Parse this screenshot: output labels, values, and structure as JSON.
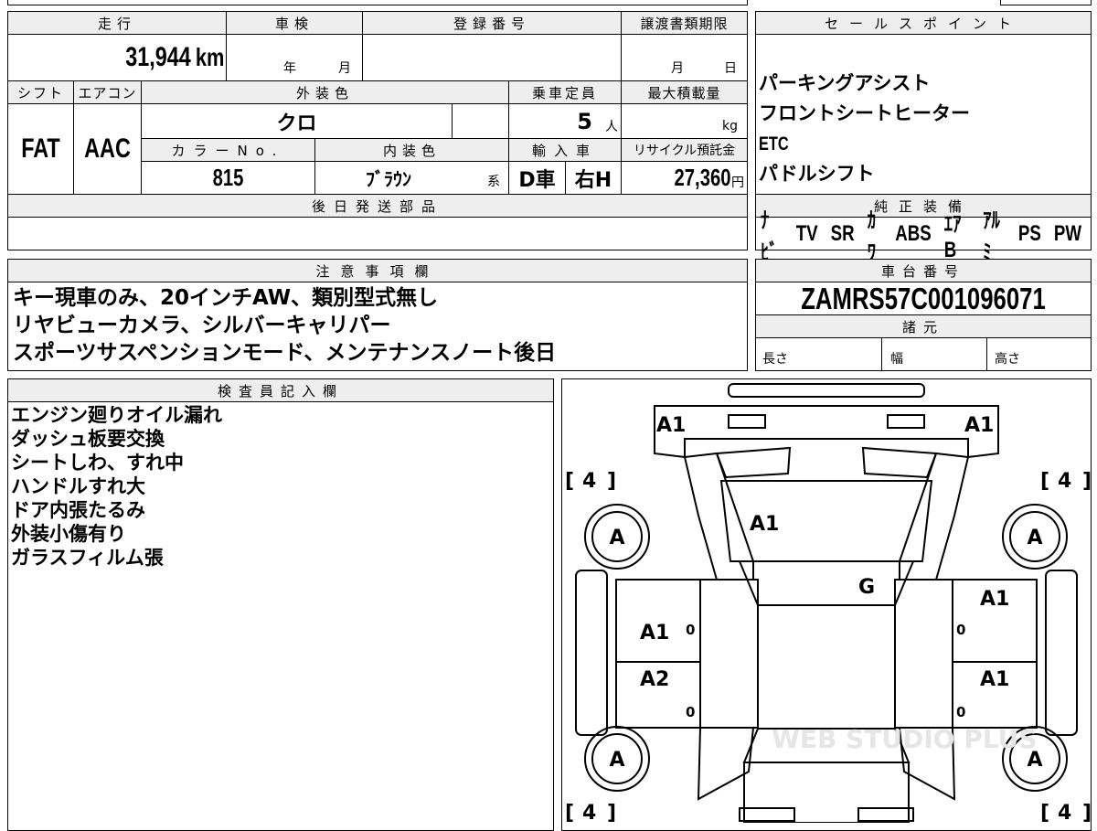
{
  "top_row": {
    "mileage_header": "走行",
    "mileage_value": "31,944",
    "mileage_unit": "km",
    "inspection_header": "車検",
    "inspection_year": "年",
    "inspection_month": "月",
    "registration_header": "登録番号",
    "transfer_header": "譲渡書類期限",
    "transfer_month": "月",
    "transfer_day": "日"
  },
  "row2": {
    "shift_header": "シフト",
    "shift_value": "FAT",
    "ac_header": "エアコン",
    "ac_value": "AAC",
    "exterior_header": "外装色",
    "exterior_value": "クロ",
    "capacity_header": "乗車定員",
    "capacity_value": "5",
    "capacity_unit": "人",
    "load_header": "最大積載量",
    "load_unit": "kg",
    "color_no_header": "カラーNo.",
    "color_no_value": "815",
    "interior_header": "内装色",
    "interior_value": "ﾌﾞﾗｳﾝ",
    "interior_suffix": "系",
    "import_header": "輸入車",
    "import_value1": "D車",
    "import_value2": "右H",
    "recycle_header": "リサイクル預託金",
    "recycle_value": "27,360",
    "recycle_unit": "円"
  },
  "later_parts": {
    "header": "後日発送部品"
  },
  "sales_points": {
    "header": "セールスポイント",
    "items": [
      "パーキングアシスト",
      "フロントシートヒーター",
      "ETC",
      "パドルシフト"
    ]
  },
  "genuine_equipment": {
    "header": "純正装備",
    "items": [
      "ﾅﾋﾞ",
      "TV",
      "SR",
      "ｶﾜ",
      "ABS",
      "ｴｱB",
      "ｱﾙﾐ",
      "PS",
      "PW"
    ]
  },
  "notes": {
    "header": "注意事項欄",
    "lines": [
      "キー現車のみ、20インチAW、類別型式無し",
      "リヤビューカメラ、シルバーキャリパー",
      "スポーツサスペンションモード、メンテナンスノート後日"
    ]
  },
  "chassis": {
    "header": "車台番号",
    "value": "ZAMRS57C001096071"
  },
  "specs": {
    "header": "諸元",
    "length": "長さ",
    "width": "幅",
    "height": "高さ"
  },
  "inspector": {
    "header": "検査員記入欄",
    "lines": [
      "エンジン廻りオイル漏れ",
      "ダッシュ板要交換",
      "シートしわ、すれ中",
      "ハンドルすれ大",
      "ドア内張たるみ",
      "外装小傷有り",
      "ガラスフィルム張"
    ]
  },
  "car_map": {
    "tire_bracket_label": "[ 4 ]",
    "tire_labels": [
      "4",
      "4",
      "4",
      "4"
    ],
    "wheel_label": "A",
    "seat_zero": "0",
    "marks": {
      "front_left": "A1",
      "front_right": "A1",
      "hood": "A1",
      "windshield": "G",
      "left_front_door": "A1",
      "left_rear_door": "A2",
      "right_front_door": "A1",
      "right_rear_door": "A1"
    },
    "watermark": "WEB STUDIO PLUS"
  }
}
